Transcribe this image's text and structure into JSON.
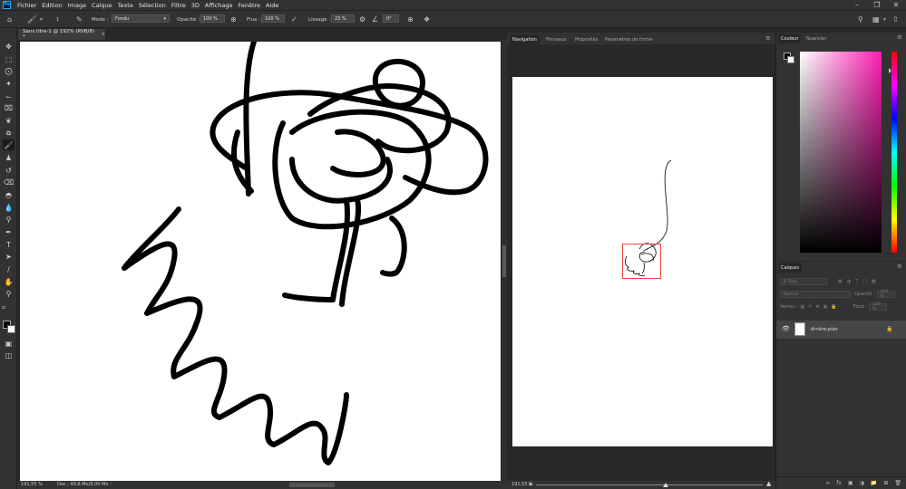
{
  "app": {
    "logo": "Ps"
  },
  "menu": [
    "Fichier",
    "Edition",
    "Image",
    "Calque",
    "Texte",
    "Sélection",
    "Filtre",
    "3D",
    "Affichage",
    "Fenêtre",
    "Aide"
  ],
  "options": {
    "brush_size": "1",
    "mode_label": "Mode :",
    "mode_value": "Fondu",
    "opacity_label": "Opacité :",
    "opacity_value": "100 %",
    "flow_label": "Flux :",
    "flow_value": "100 %",
    "smoothing_label": "Lissage :",
    "smoothing_value": "23 %",
    "angle_value": "0°"
  },
  "document": {
    "tab_title": "Sans titre-1 @ 192% (RVB/8) *"
  },
  "status": {
    "zoom": "191,55 %",
    "doc_info": "Doc : 49,8 Mo/9,00 Mo"
  },
  "navigator": {
    "tabs": [
      "Navigation",
      "Pinceaux",
      "Propriétés",
      "Paramètres de forme"
    ],
    "zoom": "191,55 %"
  },
  "color_panel": {
    "tabs": [
      "Couleur",
      "Nuancier"
    ],
    "foreground": "#000000",
    "background": "#ffffff",
    "hue_color": "#ff1fb4"
  },
  "layers_panel": {
    "tab": "Calques",
    "search_placeholder": "Type",
    "blend_mode": "Normal",
    "opacity_label": "Opacité :",
    "opacity_value": "100 %",
    "lock_label": "Verrou :",
    "fill_label": "Fond :",
    "fill_value": "100 %",
    "layer_name": "Arrière-plan"
  }
}
